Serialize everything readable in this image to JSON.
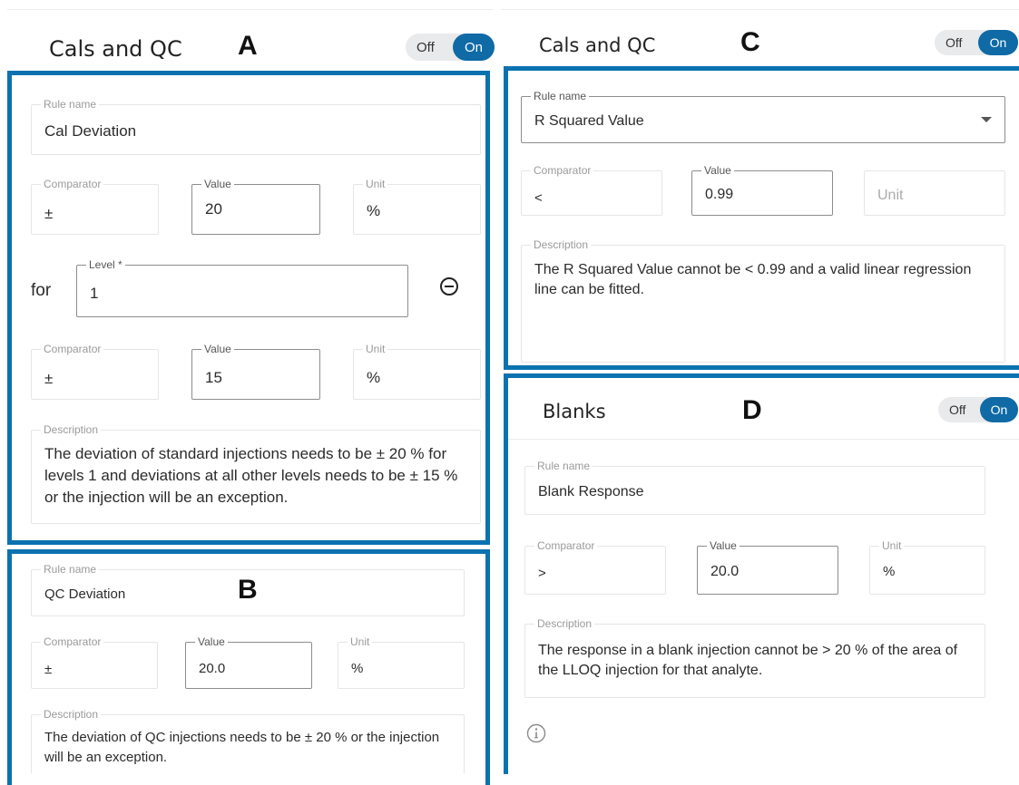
{
  "panel_a": {
    "title": "Cals and QC",
    "letter": "A",
    "toggle": {
      "off": "Off",
      "on": "On"
    },
    "rule_name": {
      "label": "Rule name",
      "value": "Cal Deviation"
    },
    "row1": {
      "comparator": {
        "label": "Comparator",
        "value": "±"
      },
      "value": {
        "label": "Value",
        "value": "20"
      },
      "unit": {
        "label": "Unit",
        "value": "%"
      }
    },
    "for_label": "for",
    "level": {
      "label": "Level *",
      "value": "1"
    },
    "row2": {
      "comparator": {
        "label": "Comparator",
        "value": "±"
      },
      "value": {
        "label": "Value",
        "value": "15"
      },
      "unit": {
        "label": "Unit",
        "value": "%"
      }
    },
    "description": {
      "label": "Description",
      "value": "The deviation of standard injections needs to be ± 20 % for levels 1 and deviations at all other levels needs to be ± 15 % or the injection will be an exception."
    }
  },
  "panel_b": {
    "letter": "B",
    "rule_name": {
      "label": "Rule name",
      "value": "QC Deviation"
    },
    "comparator": {
      "label": "Comparator",
      "value": "±"
    },
    "value": {
      "label": "Value",
      "value": "20.0"
    },
    "unit": {
      "label": "Unit",
      "value": "%"
    },
    "description": {
      "label": "Description",
      "value": "The deviation of QC injections needs to be ± 20 % or the injection will be an exception."
    }
  },
  "panel_c": {
    "title": "Cals and QC",
    "letter": "C",
    "toggle": {
      "off": "Off",
      "on": "On"
    },
    "rule_name": {
      "label": "Rule name",
      "value": "R Squared Value"
    },
    "comparator": {
      "label": "Comparator",
      "value": "<"
    },
    "value": {
      "label": "Value",
      "value": "0.99"
    },
    "unit": {
      "placeholder": "Unit"
    },
    "description": {
      "label": "Description",
      "value": "The R Squared Value cannot be < 0.99 and a valid linear regression line can be fitted."
    }
  },
  "panel_d": {
    "title": "Blanks",
    "letter": "D",
    "toggle": {
      "off": "Off",
      "on": "On"
    },
    "rule_name": {
      "label": "Rule name",
      "value": "Blank Response"
    },
    "comparator": {
      "label": "Comparator",
      "value": ">"
    },
    "value": {
      "label": "Value",
      "value": "20.0"
    },
    "unit": {
      "label": "Unit",
      "value": "%"
    },
    "description": {
      "label": "Description",
      "value": "The response in a blank injection cannot be > 20 % of the area of the LLOQ injection for that analyte."
    },
    "info_icon": "info-icon"
  },
  "colors": {
    "accent": "#0b72b0",
    "toggle_on": "#0f6aa6",
    "toggle_off_bg": "#e9eaec"
  }
}
